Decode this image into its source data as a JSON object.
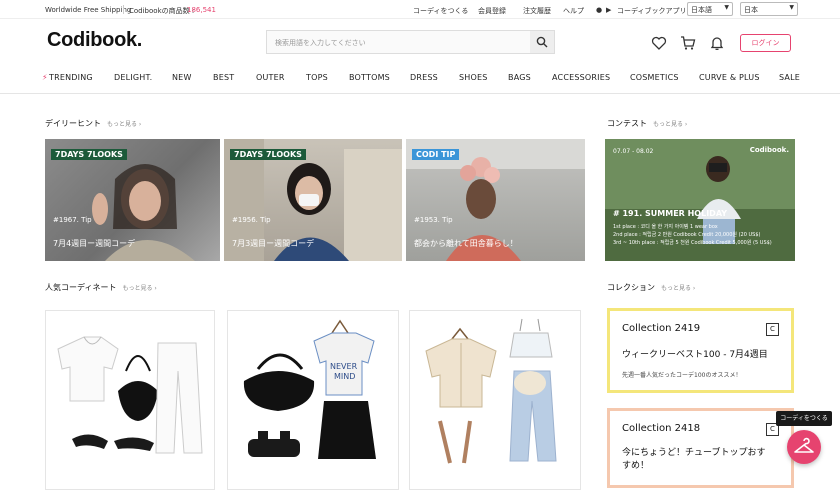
{
  "topbar": {
    "shipping": "Worldwide Free Shipping",
    "count_label": "Codibookの商品数 :",
    "count_value": "186,541",
    "links": [
      "コーディをつくる",
      "会員登録",
      "注文履歴",
      "ヘルプ",
      "コーディブックアプリ"
    ],
    "language": "日本語",
    "country": "日本"
  },
  "header": {
    "logo": "Codibook.",
    "search_placeholder": "検索用語を入力してください",
    "login": "ログイン"
  },
  "nav": [
    "TRENDING",
    "DELIGHT.",
    "NEW",
    "BEST",
    "OUTER",
    "TOPS",
    "BOTTOMS",
    "DRESS",
    "SHOES",
    "BAGS",
    "ACCESSORIES",
    "COSMETICS",
    "CURVE & PLUS",
    "SALE"
  ],
  "daily": {
    "title": "デイリーヒント",
    "more": "もっと見る ›",
    "cards": [
      {
        "badge": "7DAYS 7LOOKS",
        "tip": "#1967. Tip",
        "title": "7月4週目ー週間コーデ"
      },
      {
        "badge": "7DAYS 7LOOKS",
        "tip": "#1956. Tip",
        "title": "7月3週目ー週間コーデ"
      },
      {
        "badge": "CODI TIP",
        "tip": "#1953. Tip",
        "title": "都会から離れて田舎暮らし！"
      }
    ]
  },
  "contest": {
    "title": "コンテスト",
    "more": "もっと見る ›",
    "brand": "Codibook.",
    "dates": "07.07 - 08.02",
    "headline": "# 191. SUMMER HOLIDAY",
    "lines": [
      "1st place : 코디 올 한 가지 아이템 1 wear box",
      "2nd place : 적립금 2 만원 Codibook Credit 20,000원 (20 US$)",
      "3rd ~ 10th place : 적립금 5 천원 Codibook Credit 5,000원 (5 US$)"
    ]
  },
  "popular": {
    "title": "人気コーディネート",
    "more": "もっと見る ›"
  },
  "collection": {
    "title": "コレクション",
    "more": "もっと見る ›",
    "items": [
      {
        "name": "Collection 2419",
        "subtitle": "ウィークリーベスト100 - 7月4週目",
        "desc": "先週一番人気だったコーデ100のオススメ！",
        "color": "#f4e67a"
      },
      {
        "name": "Collection 2418",
        "subtitle": "今にちょうど！チューブトップおすすめ！",
        "desc": "",
        "color": "#f5c8ae"
      }
    ]
  },
  "fab": {
    "tooltip": "コーディをつくる"
  }
}
